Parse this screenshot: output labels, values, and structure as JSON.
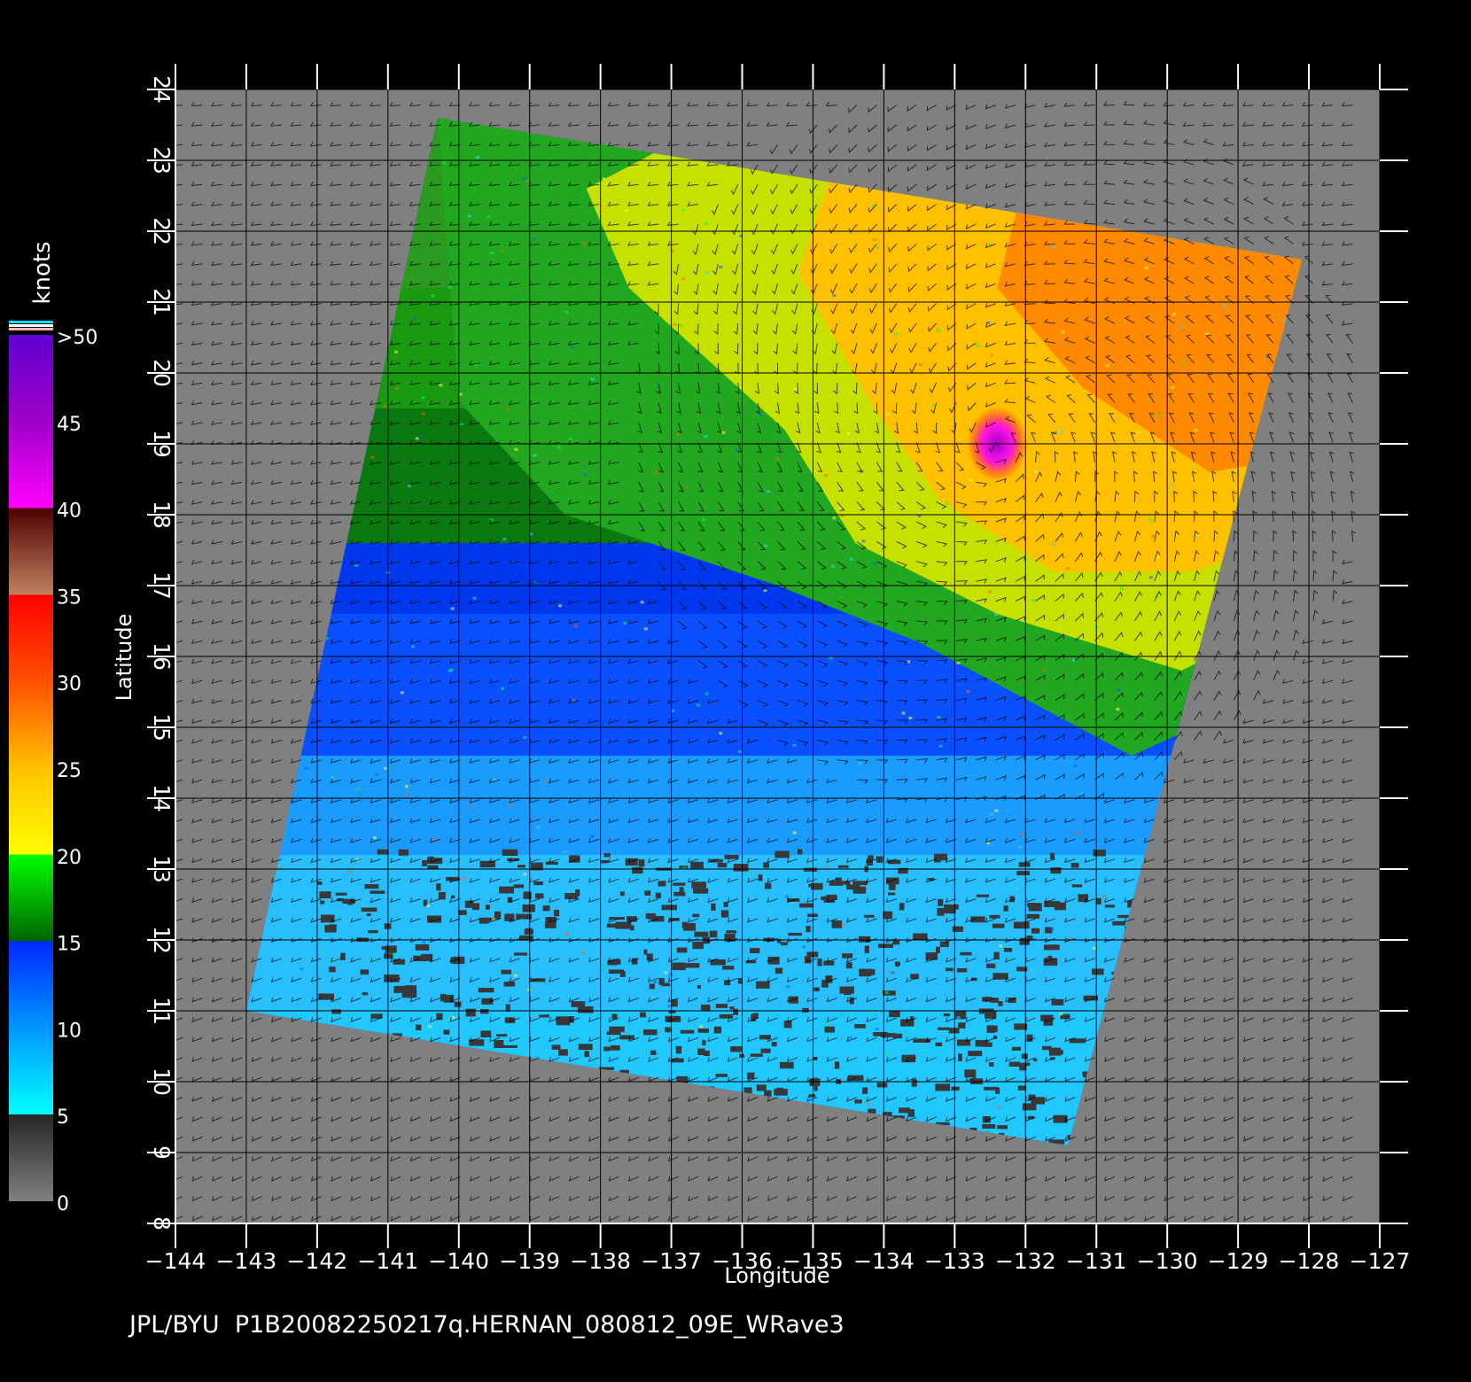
{
  "map": {
    "x_axis_label": "Longitude",
    "y_axis_label": "Latitude",
    "lon_range": [
      -144,
      -127
    ],
    "lat_range": [
      8,
      24
    ],
    "lon_ticks": [
      "−144",
      "−143",
      "−142",
      "−141",
      "−140",
      "−139",
      "−138",
      "−137",
      "−136",
      "−135",
      "−134",
      "−133",
      "−132",
      "−131",
      "−130",
      "−129",
      "−128",
      "−127"
    ],
    "lat_ticks": [
      "8",
      "9",
      "10",
      "11",
      "12",
      "13",
      "14",
      "15",
      "16",
      "17",
      "18",
      "19",
      "20",
      "21",
      "22",
      "23",
      "24"
    ],
    "grid": true,
    "background_color": "#808080",
    "storm_center": {
      "lon": -132.4,
      "lat": 19.0
    },
    "swath_corners_lonlat": [
      [
        -140.3,
        23.6
      ],
      [
        -128.1,
        21.6
      ],
      [
        -131.4,
        9.1
      ],
      [
        -143.0,
        11.0
      ]
    ]
  },
  "colorbar": {
    "unit": "knots",
    "labels": [
      ">50",
      "45",
      "40",
      "35",
      "30",
      "25",
      "20",
      "15",
      "10",
      "5",
      "0"
    ],
    "stops": [
      {
        "knots": 0,
        "color": "#808080"
      },
      {
        "knots": 5,
        "color": "#262626"
      },
      {
        "knots": 5.01,
        "color": "#00ffff"
      },
      {
        "knots": 10,
        "color": "#0096ff"
      },
      {
        "knots": 15,
        "color": "#0028ff"
      },
      {
        "knots": 15.01,
        "color": "#006400"
      },
      {
        "knots": 20,
        "color": "#00ff00"
      },
      {
        "knots": 20.01,
        "color": "#ffff00"
      },
      {
        "knots": 25,
        "color": "#ffc000"
      },
      {
        "knots": 30,
        "color": "#ff5000"
      },
      {
        "knots": 35,
        "color": "#ff0000"
      },
      {
        "knots": 35.01,
        "color": "#c08060"
      },
      {
        "knots": 40,
        "color": "#500000"
      },
      {
        "knots": 40.01,
        "color": "#ff00ff"
      },
      {
        "knots": 45,
        "color": "#a000c8"
      },
      {
        "knots": 50,
        "color": "#6000d0"
      }
    ]
  },
  "footer": "JPL/BYU  P1B20082250217q.HERNAN_080812_09E_WRave3"
}
